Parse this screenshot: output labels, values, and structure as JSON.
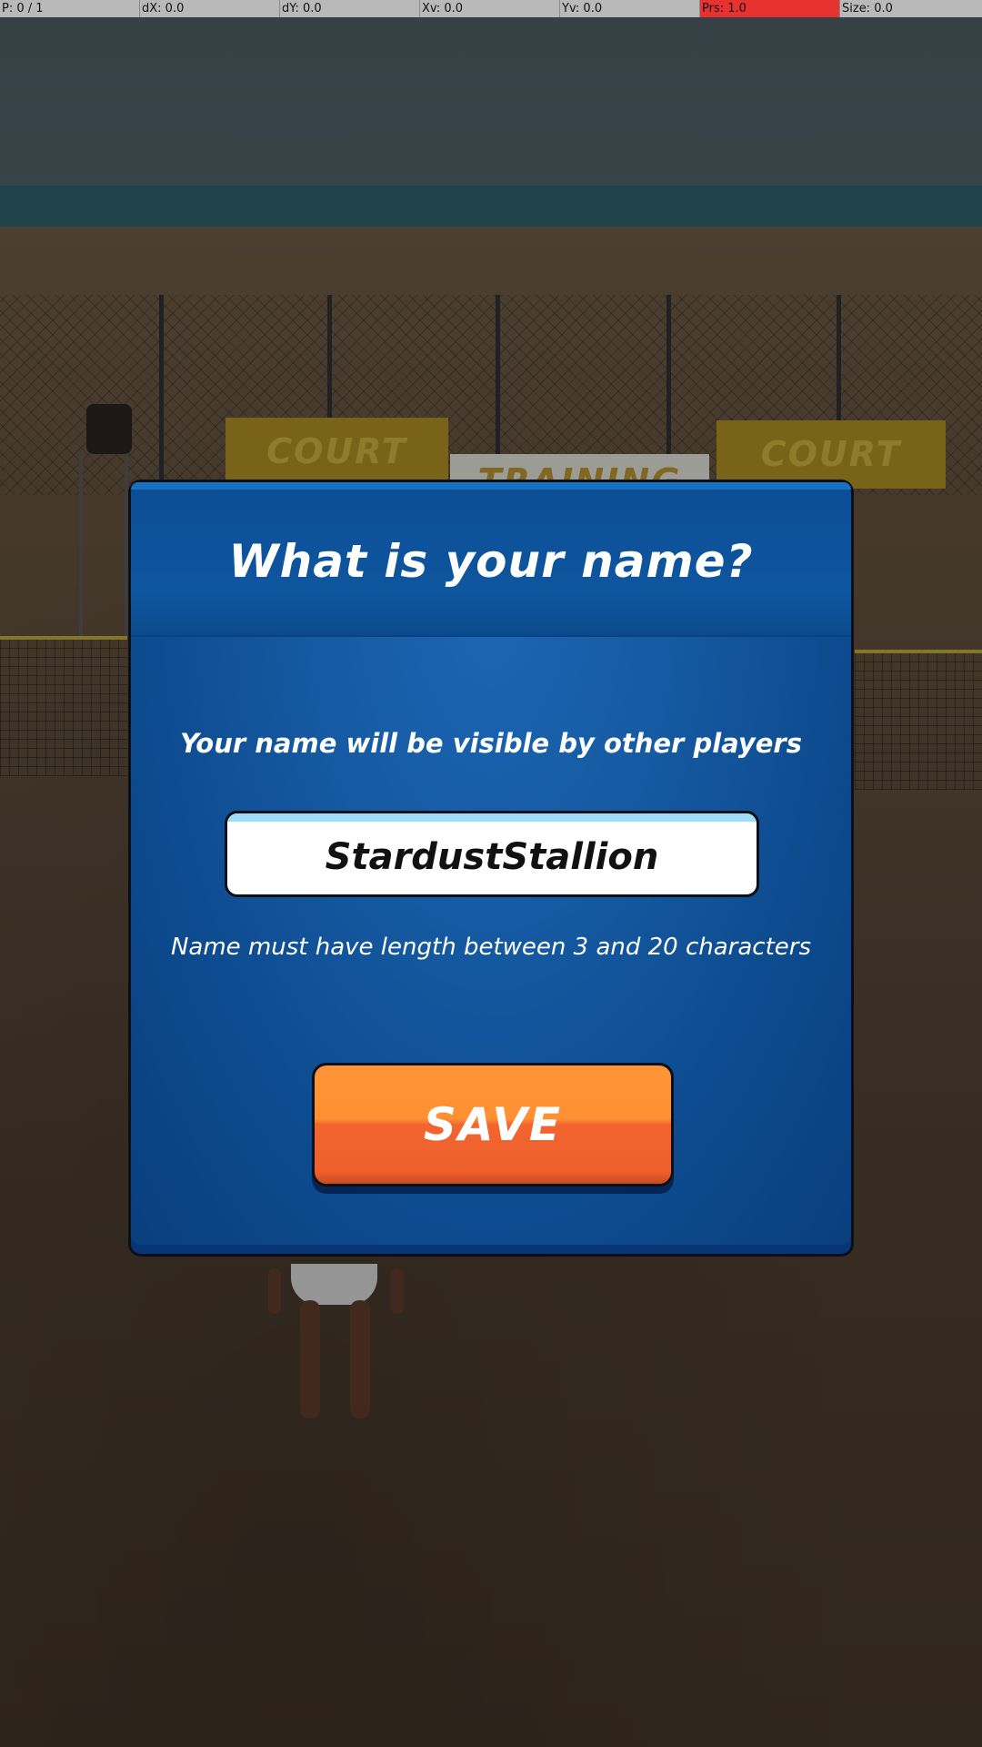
{
  "debug_bar": {
    "pointer": "P: 0 / 1",
    "dx": "dX: 0.0",
    "dy": "dY: 0.0",
    "xv": "Xv: 0.0",
    "yv": "Yv: 0.0",
    "pressure": "Prs: 1.0",
    "size": "Size: 0.0"
  },
  "scene": {
    "banner_left": "COURT",
    "banner_center": "TRAINING",
    "banner_right": "COURT"
  },
  "dialog": {
    "title": "What is your name?",
    "subtitle": "Your name will be visible by other players",
    "name_value": "StardustStallion",
    "hint": "Name must have length between 3 and 20 characters",
    "save_label": "SAVE"
  },
  "colors": {
    "dialog_blue": "#155aa2",
    "save_orange": "#ff9033",
    "pressure_alert": "#e8322f"
  }
}
